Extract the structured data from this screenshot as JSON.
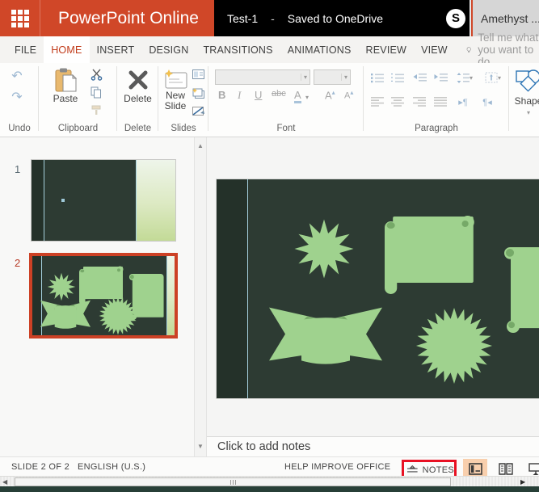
{
  "app": {
    "name": "PowerPoint Online",
    "document_title": "Test-1",
    "separator": "-",
    "save_status": "Saved to OneDrive",
    "skype_letter": "S",
    "user": "Amethyst ..."
  },
  "menu": {
    "tabs": [
      {
        "label": "FILE",
        "active": false
      },
      {
        "label": "HOME",
        "active": true
      },
      {
        "label": "INSERT",
        "active": false
      },
      {
        "label": "DESIGN",
        "active": false
      },
      {
        "label": "TRANSITIONS",
        "active": false
      },
      {
        "label": "ANIMATIONS",
        "active": false
      },
      {
        "label": "REVIEW",
        "active": false
      },
      {
        "label": "VIEW",
        "active": false
      }
    ],
    "tell_me_placeholder": "Tell me what you want to do"
  },
  "ribbon": {
    "undo": {
      "label": "Undo"
    },
    "clipboard": {
      "label": "Clipboard",
      "paste_label": "Paste"
    },
    "delete": {
      "label": "Delete",
      "button_label": "Delete"
    },
    "slides": {
      "label": "Slides",
      "new_slide_label": "New Slide"
    },
    "font": {
      "label": "Font",
      "bold": "B",
      "italic": "I",
      "underline": "U",
      "strikethrough": "abc",
      "font_color": "A",
      "grow_font": "A",
      "shrink_font": "A"
    },
    "paragraph": {
      "label": "Paragraph"
    },
    "shape": {
      "label": "Shape"
    }
  },
  "slide_panel": {
    "slides": [
      {
        "number": "1",
        "selected": false
      },
      {
        "number": "2",
        "selected": true
      }
    ]
  },
  "notes": {
    "placeholder": "Click to add notes"
  },
  "status_bar": {
    "slide_indicator": "SLIDE 2 OF 2",
    "language": "ENGLISH (U.S.)",
    "help_improve": "HELP IMPROVE OFFICE",
    "notes_label": "NOTES"
  },
  "colors": {
    "accent_orange": "#d04728",
    "titlebar_black": "#000000",
    "user_area_gray": "#d6d6d6",
    "active_tab_red": "#c13b1a",
    "slide_bg_green": "#2d3b33",
    "slide_strip_green": "#243129",
    "shape_green": "#9fd28e",
    "shape_green_dark": "#76a968",
    "guide_blue": "#a5d0dd",
    "selection_red": "#cc4125",
    "annotation_red": "#e81123",
    "active_view_peach": "#f8cfad",
    "footer_strip": "#273f37"
  }
}
